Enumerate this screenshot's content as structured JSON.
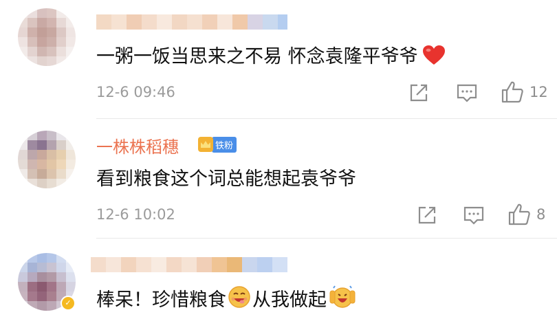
{
  "comments": [
    {
      "username": "",
      "username_obscured": true,
      "text": "一粥一饭当思来之不易 怀念袁隆平爷爷",
      "trailing_emoji": "heart-icon",
      "time": "12-6 09:46",
      "like_count": "12",
      "avatar_obscured": true
    },
    {
      "username": "一株株稻穗",
      "badge_label": "铁粉",
      "text": "看到粮食这个词总能想起袁爷爷",
      "time": "12-6 10:02",
      "like_count": "8",
      "avatar_obscured": true
    },
    {
      "username": "",
      "username_obscured": true,
      "text_part1": "棒呆！珍惜粮食",
      "text_part2": "从我做起",
      "emoji_1": "yum-face-icon",
      "emoji_2": "cheer-face-icon",
      "avatar_obscured": true,
      "verified": true
    }
  ],
  "colors": {
    "username_orange": "#eb7350",
    "badge_blue": "#4a8ee8",
    "heart_red": "#e8332e",
    "meta_gray": "#9b9b9b"
  }
}
